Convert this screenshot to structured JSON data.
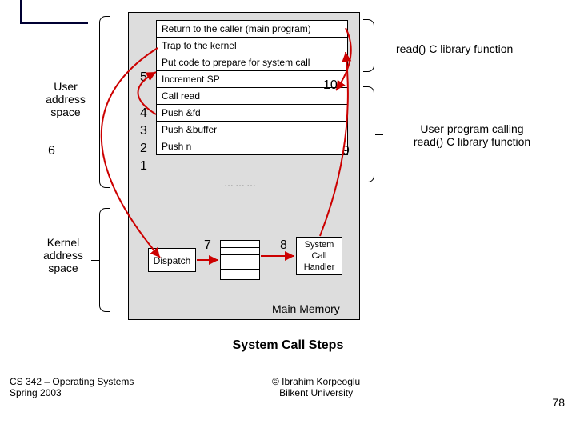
{
  "stack": {
    "row0": "Return to the caller (main program)",
    "row1": "Trap to the kernel",
    "row2": "Put code to prepare for system call",
    "row3": "Increment SP",
    "row4": "Call read",
    "row5": "Push &fd",
    "row6": "Push &buffer",
    "row7": "Push n"
  },
  "nums": {
    "n1": "1",
    "n2": "2",
    "n3": "3",
    "n4": "4",
    "n5": "5",
    "n6": "6",
    "n7": "7",
    "n8": "8",
    "n9": "9",
    "n10": "10"
  },
  "dots": "………",
  "dispatch": "Dispatch",
  "syscall": {
    "l1": "System",
    "l2": "Call",
    "l3": "Handler"
  },
  "mainmem": "Main Memory",
  "title": "System Call Steps",
  "labels": {
    "user_l1": "User",
    "user_l2": "address",
    "user_l3": "space",
    "kernel_l1": "Kernel",
    "kernel_l2": "address",
    "kernel_l3": "space",
    "read": "read()  C library function",
    "userprog_l1": "User program calling",
    "userprog_l2": "read() C library function"
  },
  "footer": {
    "left_l1": "CS 342 – Operating Systems",
    "left_l2": "Spring 2003",
    "mid_l1": "© Ibrahim Korpeoglu",
    "mid_l2": "Bilkent University",
    "right": "78"
  }
}
